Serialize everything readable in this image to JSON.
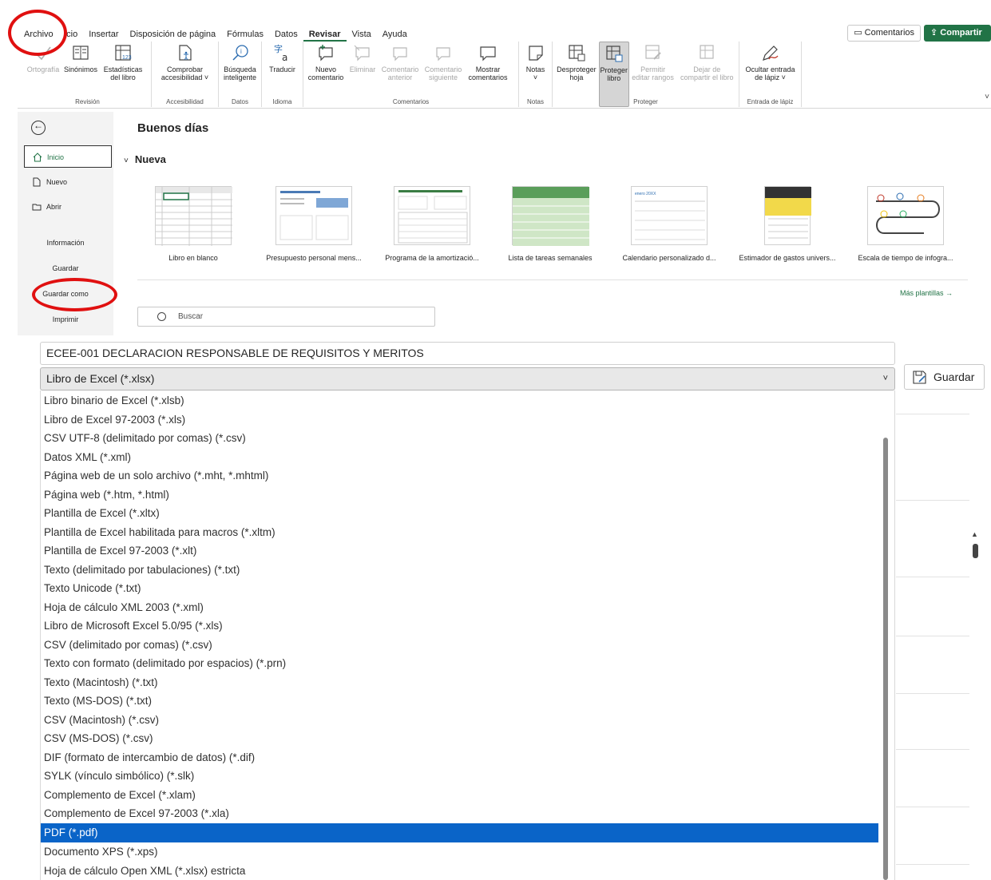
{
  "ribbon": {
    "tabs": [
      "Archivo",
      "Inicio",
      "Insertar",
      "Disposición de página",
      "Fórmulas",
      "Datos",
      "Revisar",
      "Vista",
      "Ayuda"
    ],
    "tab_inicio_visible": "icio",
    "active_tab": "Revisar",
    "comments_button": "Comentarios",
    "share_button": "Compartir",
    "groups": {
      "revision": {
        "label": "Revisión",
        "buttons": [
          "Ortografía",
          "Sinónimos",
          "Estadísticas",
          "del libro"
        ]
      },
      "accesibilidad": {
        "label": "Accesibilidad",
        "buttons": [
          "Comprobar",
          "accesibilidad"
        ]
      },
      "datos": {
        "label": "Datos",
        "buttons": [
          "Búsqueda",
          "inteligente"
        ]
      },
      "idioma": {
        "label": "Idioma",
        "buttons": [
          "Traducir"
        ]
      },
      "comentarios": {
        "label": "Comentarios",
        "buttons": [
          "Nuevo",
          "comentario",
          "Eliminar",
          "Comentario",
          "anterior",
          "Comentario",
          "siguiente",
          "Mostrar",
          "comentarios"
        ]
      },
      "notas": {
        "label": "Notas",
        "buttons": [
          "Notas"
        ]
      },
      "proteger": {
        "label": "Proteger",
        "buttons": [
          "Desproteger",
          "hoja",
          "Proteger",
          "libro",
          "Permitir",
          "editar rangos",
          "Dejar de",
          "compartir el libro"
        ]
      },
      "lapiz": {
        "label": "Entrada de lápiz",
        "buttons": [
          "Ocultar entrada",
          "de lápiz"
        ]
      }
    }
  },
  "nav": {
    "items": [
      "Inicio",
      "Nuevo",
      "Abrir"
    ],
    "text_items": [
      "Información",
      "Guardar",
      "Guardar como",
      "Imprimir"
    ]
  },
  "home": {
    "greeting": "Buenos días",
    "new_section": "Nueva",
    "templates": [
      "Libro en blanco",
      "Presupuesto personal mens...",
      "Programa de la amortizació...",
      "Lista de tareas semanales",
      "Calendario personalizado d...",
      "Estimador de gastos univers...",
      "Escala de tiempo de infogra..."
    ],
    "more_templates": "Más plantillas",
    "search_placeholder": "Buscar",
    "calendar_text": "enero 20XX"
  },
  "save_as": {
    "file_name": "ECEE-001 DECLARACION RESPONSABLE DE REQUISITOS Y MERITOS",
    "file_type": "Libro de Excel (*.xlsx)",
    "save_button": "Guardar",
    "options": [
      "Libro binario de Excel (*.xlsb)",
      "Libro de Excel 97-2003 (*.xls)",
      "CSV UTF-8 (delimitado por comas) (*.csv)",
      "Datos XML (*.xml)",
      "Página web de un solo archivo (*.mht, *.mhtml)",
      "Página web (*.htm, *.html)",
      "Plantilla de Excel (*.xltx)",
      "Plantilla de Excel habilitada para macros (*.xltm)",
      "Plantilla de Excel 97-2003 (*.xlt)",
      "Texto (delimitado por tabulaciones) (*.txt)",
      "Texto Unicode (*.txt)",
      "Hoja de cálculo XML 2003 (*.xml)",
      "Libro de Microsoft Excel 5.0/95 (*.xls)",
      "CSV (delimitado por comas) (*.csv)",
      "Texto con formato (delimitado por espacios) (*.prn)",
      "Texto (Macintosh) (*.txt)",
      "Texto (MS-DOS) (*.txt)",
      "CSV (Macintosh) (*.csv)",
      "CSV (MS-DOS) (*.csv)",
      "DIF (formato de intercambio de datos) (*.dif)",
      "SYLK (vínculo simbólico) (*.slk)",
      "Complemento de Excel (*.xlam)",
      "Complemento de Excel 97-2003 (*.xla)",
      "PDF (*.pdf)",
      "Documento XPS (*.xps)",
      "Hoja de cálculo Open XML (*.xlsx) estricta"
    ],
    "selected_option": "PDF (*.pdf)"
  },
  "colors": {
    "brand": "#217346",
    "selection": "#0a64c8",
    "annotation": "#e01010"
  }
}
